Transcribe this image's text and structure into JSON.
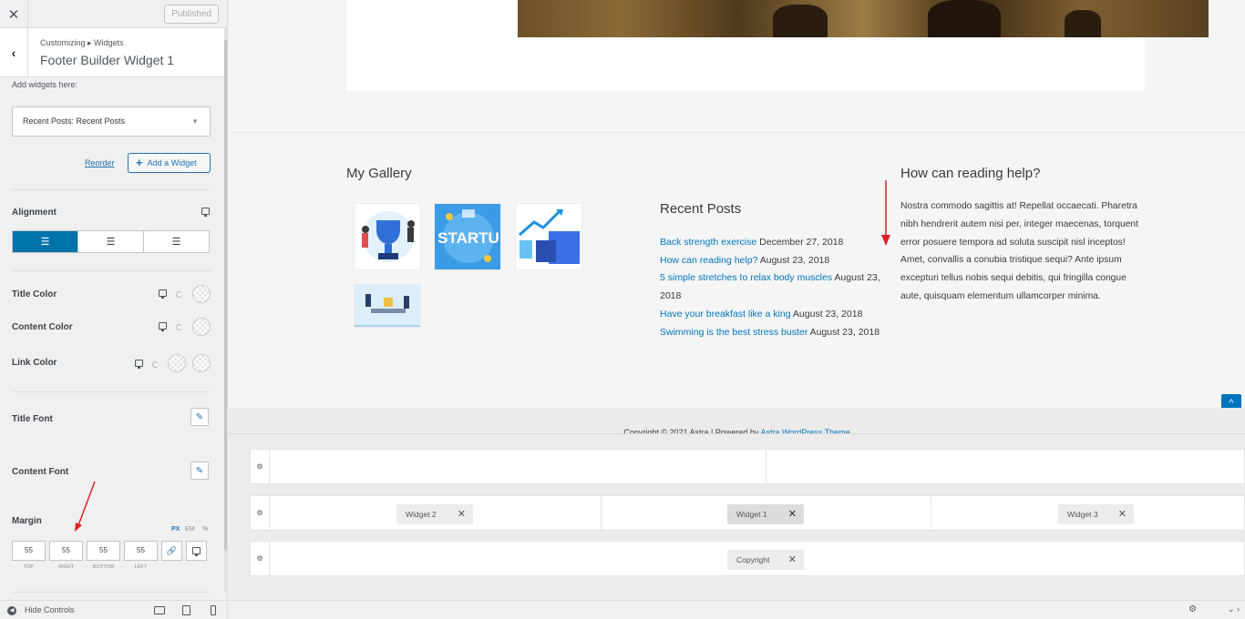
{
  "sidebar": {
    "close_icon": "close-icon",
    "published_label": "Published",
    "breadcrumb": "Customizing ▸ Widgets",
    "section_title": "Footer Builder Widget 1",
    "add_widgets_label": "Add widgets here:",
    "widget_select_value": "Recent Posts: Recent Posts",
    "reorder_label": "Reorder",
    "add_widget_label": "Add a Widget",
    "alignment_label": "Alignment",
    "alignment_options": [
      "left",
      "center",
      "right"
    ],
    "alignment_selected": "left",
    "title_color_label": "Title Color",
    "content_color_label": "Content Color",
    "link_color_label": "Link Color",
    "title_font_label": "Title Font",
    "content_font_label": "Content Font",
    "margin_label": "Margin",
    "units": [
      "PX",
      "EM",
      "%"
    ],
    "unit_selected": "PX",
    "margin_values": {
      "top": "55",
      "right": "55",
      "bottom": "55",
      "left": "55"
    },
    "margin_labels": {
      "top": "TOP",
      "right": "RIGHT",
      "bottom": "BOTTOM",
      "left": "LEFT"
    },
    "hide_controls_label": "Hide Controls"
  },
  "preview": {
    "gallery_title": "My Gallery",
    "gallery_images": [
      "trophy-team",
      "startup",
      "business-charts",
      "meeting"
    ],
    "recent_posts_title": "Recent Posts",
    "recent_posts": [
      {
        "title": "Back strength exercise",
        "date": "December 27, 2018"
      },
      {
        "title": "How can reading help?",
        "date": "August 23, 2018"
      },
      {
        "title": "5 simple stretches to relax body muscles",
        "date": "August 23, 2018"
      },
      {
        "title": "Have your breakfast like a king",
        "date": "August 23, 2018"
      },
      {
        "title": "Swimming is the best stress buster",
        "date": "August 23, 2018"
      }
    ],
    "text_widget_title": "How can reading help?",
    "text_widget_body": "Nostra commodo sagittis at! Repellat occaecati. Pharetra nibh hendrerit autem nisi per, integer maecenas, torquent error posuere tempora ad soluta suscipit nisl inceptos! Amet, convallis a conubia tristique sequi? Ante ipsum excepturi tellus nobis sequi debitis, qui fringilla congue aute, quisquam elementum ullamcorper minima.",
    "copyright_text": "Copyright © 2021 Astra | Powered by",
    "copyright_link": "Astra WordPress Theme"
  },
  "builder": {
    "row2": {
      "widget2": "Widget 2",
      "widget1": "Widget 1",
      "widget3": "Widget 3"
    },
    "row3": {
      "copyright": "Copyright"
    }
  },
  "colors": {
    "accent": "#0073aa",
    "link": "#0274be",
    "annotation_arrow": "#e02020"
  }
}
